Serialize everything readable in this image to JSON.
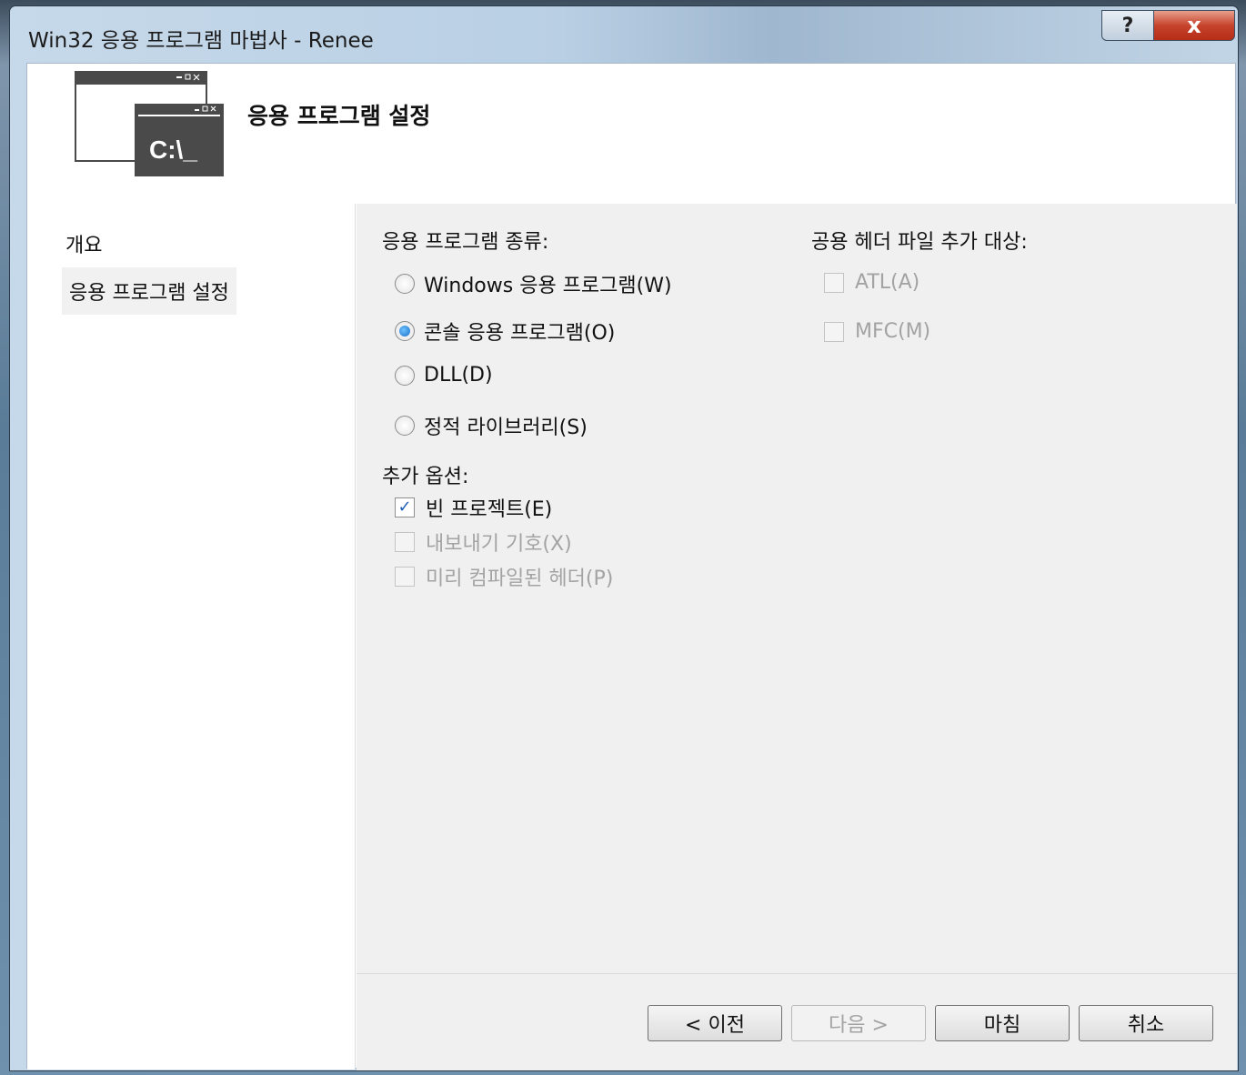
{
  "window": {
    "title": "Win32 응용 프로그램 마법사 - Renee",
    "help_label": "?",
    "close_label": "x"
  },
  "header": {
    "title": "응용 프로그램 설정",
    "icon_text": "C:\\_"
  },
  "sidebar": {
    "items": [
      {
        "label": "개요"
      },
      {
        "label": "응용 프로그램 설정"
      }
    ]
  },
  "app_type": {
    "label": "응용 프로그램 종류:",
    "options": [
      {
        "label": "Windows 응용 프로그램(W)",
        "selected": false
      },
      {
        "label": "콘솔 응용 프로그램(O)",
        "selected": true
      },
      {
        "label": "DLL(D)",
        "selected": false
      },
      {
        "label": "정적 라이브러리(S)",
        "selected": false
      }
    ]
  },
  "additional_options": {
    "label": "추가 옵션:",
    "options": [
      {
        "label": "빈 프로젝트(E)",
        "checked": true,
        "enabled": true
      },
      {
        "label": "내보내기 기호(X)",
        "checked": false,
        "enabled": false
      },
      {
        "label": "미리 컴파일된 헤더(P)",
        "checked": false,
        "enabled": false
      }
    ]
  },
  "common_headers": {
    "label": "공용 헤더 파일 추가 대상:",
    "options": [
      {
        "label": "ATL(A)",
        "checked": false,
        "enabled": false
      },
      {
        "label": "MFC(M)",
        "checked": false,
        "enabled": false
      }
    ]
  },
  "buttons": {
    "prev": "< 이전",
    "next": "다음 >",
    "finish": "마침",
    "cancel": "취소"
  },
  "colors": {
    "accent": "#1a6fc7",
    "close_button": "#c6432c"
  }
}
